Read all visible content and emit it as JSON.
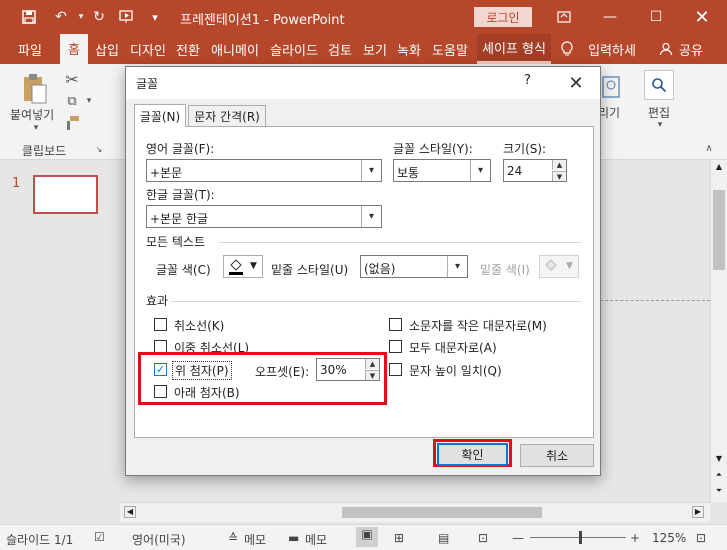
{
  "app": {
    "title": "프레젠테이션1  -  PowerPoint",
    "login_label": "로그인",
    "accent_color": "#b7472a"
  },
  "tabs": [
    {
      "label": "파일"
    },
    {
      "label": "홈"
    },
    {
      "label": "삽입"
    },
    {
      "label": "디자인"
    },
    {
      "label": "전환"
    },
    {
      "label": "애니메이"
    },
    {
      "label": "슬라이드"
    },
    {
      "label": "검토"
    },
    {
      "label": "보기"
    },
    {
      "label": "녹화"
    },
    {
      "label": "도움말"
    },
    {
      "label": "셰이프 형식"
    },
    {
      "label": "입력하세"
    },
    {
      "label": "공유"
    }
  ],
  "ribbon": {
    "paste_label": "붙여넣기",
    "clipboard_group": "클립보드",
    "right_partial_label": "리기",
    "edit_label": "편집"
  },
  "slides": {
    "number": "1"
  },
  "dialog": {
    "title": "글꼴",
    "help": "?",
    "tabs": [
      "글꼴(N)",
      "문자 간격(R)"
    ],
    "latin_font_label": "영어 글꼴(F):",
    "latin_font_value": "+본문",
    "korean_font_label": "한글 글꼴(T):",
    "korean_font_value": "+본문 한글",
    "style_label": "글꼴 스타일(Y):",
    "style_value": "보통",
    "size_label": "크기(S):",
    "size_value": "24",
    "all_text_section": "모든 텍스트",
    "font_color_label": "글꼴 색(C)",
    "underline_style_label": "밑줄 스타일(U)",
    "underline_style_value": "(없음)",
    "underline_color_label": "밑줄 색(I)",
    "effects_section": "효과",
    "effects": {
      "strikethrough": {
        "label": "취소선(K)",
        "checked": false
      },
      "double_strikethrough": {
        "label": "이중 취소선(L)",
        "checked": false
      },
      "superscript": {
        "label": "위 첨자(P)",
        "checked": true
      },
      "subscript": {
        "label": "아래 첨자(B)",
        "checked": false
      },
      "small_caps": {
        "label": "소문자를 작은 대문자로(M)",
        "checked": false
      },
      "all_caps": {
        "label": "모두 대문자로(A)",
        "checked": false
      },
      "equalize_height": {
        "label": "문자 높이 일치(Q)",
        "checked": false
      }
    },
    "offset_label": "오프셋(E):",
    "offset_value": "30%",
    "ok_label": "확인",
    "cancel_label": "취소"
  },
  "status": {
    "slide_info": "슬라이드 1/1",
    "language": "영어(미국)",
    "notes_left": "메모",
    "notes_right": "메모",
    "zoom": "125%"
  }
}
